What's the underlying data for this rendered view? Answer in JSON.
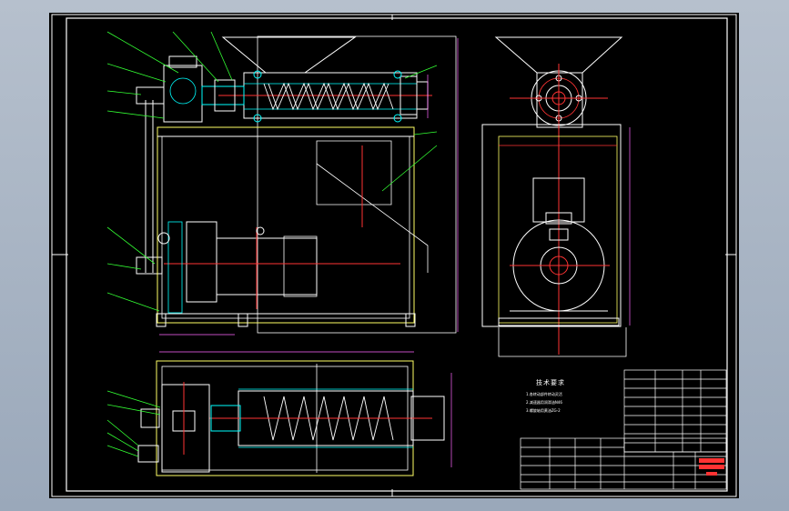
{
  "drawing": {
    "tech_requirements_title": "技术要求",
    "tech_requirements": [
      "1.各转动部件转动灵活",
      "2.减速器用润滑油N46",
      "3.螺旋轴用黄油ZG-2"
    ]
  },
  "colors": {
    "background": "#000000",
    "frame": "#ffffff",
    "outline": "#ffffff",
    "centerline": "#ff3333",
    "hidden": "#ffff66",
    "leader": "#33ff33",
    "part": "#00ffff",
    "dimension": "#ff66ff",
    "viewport": "#a6b2c2"
  }
}
